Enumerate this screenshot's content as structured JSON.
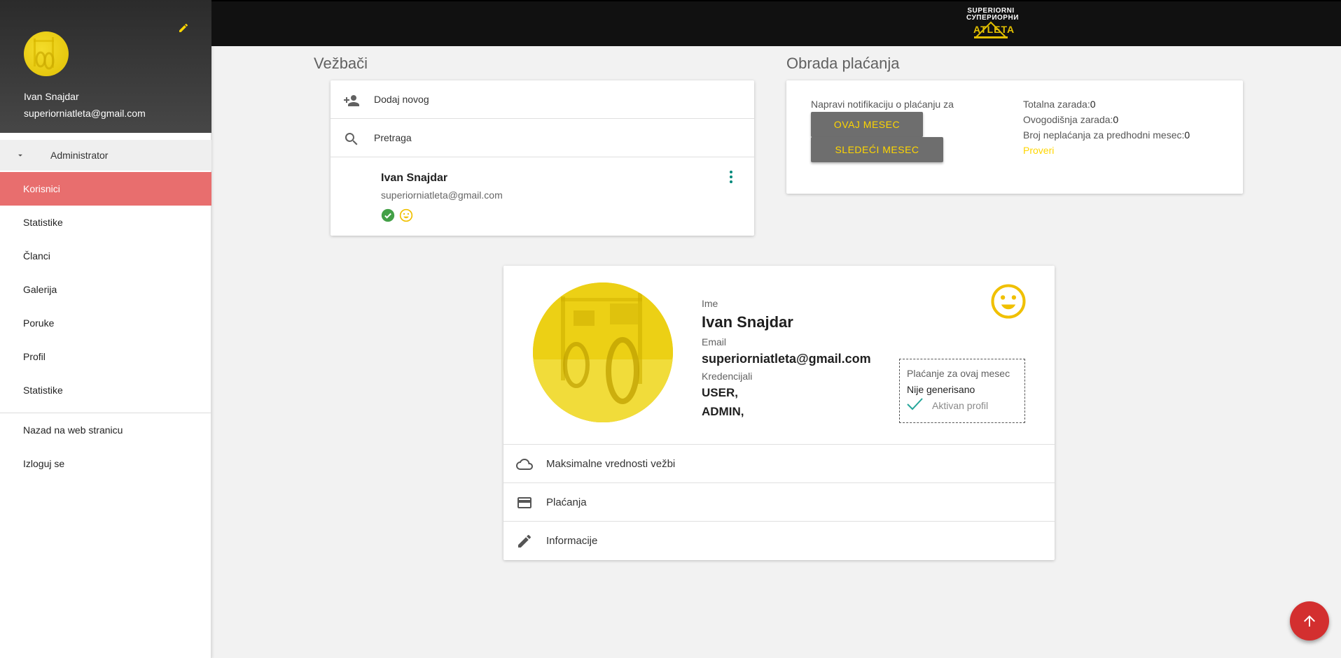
{
  "topbar": {
    "logo_line1": "SUPERIORNI",
    "logo_line2": "СУПЕРИОРНИ",
    "logo_line3": "ATLETA",
    "logo_icon": "barbell-logo-icon"
  },
  "sidebar": {
    "user_name": "Ivan Snajdar",
    "user_email": "superiorniatleta@gmail.com",
    "group_label": "Administrator",
    "items": [
      {
        "label": "Korisnici",
        "active": true
      },
      {
        "label": "Statistike",
        "active": false
      },
      {
        "label": "Članci",
        "active": false
      },
      {
        "label": "Galerija",
        "active": false
      },
      {
        "label": "Poruke",
        "active": false
      },
      {
        "label": "Profil",
        "active": false
      },
      {
        "label": "Statistike",
        "active": false
      }
    ],
    "footer_items": [
      {
        "label": "Nazad na web stranicu"
      },
      {
        "label": "Izloguj se"
      }
    ],
    "accent_color": "#e86e6e"
  },
  "vezbaci": {
    "title": "Vežbači",
    "add_label": "Dodaj novog",
    "search_label": "Pretraga",
    "user": {
      "name": "Ivan Snajdar",
      "email": "superiorniatleta@gmail.com",
      "status_icons": [
        "check-circle-icon",
        "smile-icon"
      ]
    }
  },
  "placanja": {
    "title": "Obrada plaćanja",
    "notify_label": "Napravi notifikaciju o plaćanju za",
    "btn_this_month": "OVAJ MESEC",
    "btn_next_month": "SLEDEĆI MESEC",
    "total_label": "Totalna zarada:",
    "total_value": "0",
    "year_label": "Ovogodišnja zarada:",
    "year_value": "0",
    "unpaid_label": "Broj neplaćanja za predhodni mesec:",
    "unpaid_value": "0",
    "check_link": "Proveri"
  },
  "profile": {
    "name_label": "Ime",
    "name": "Ivan Snajdar",
    "email_label": "Email",
    "email": "superiorniatleta@gmail.com",
    "cred_label": "Kredencijali",
    "cred_1": "USER,",
    "cred_2": "ADMIN,",
    "payment_title": "Plaćanje za ovaj mesec",
    "payment_status": "Nije generisano",
    "active_label": "Aktivan profil",
    "rows": [
      {
        "label": "Maksimalne vrednosti vežbi",
        "icon": "cloud-icon"
      },
      {
        "label": "Plaćanja",
        "icon": "credit-card-icon"
      },
      {
        "label": "Informacije",
        "icon": "pencil-icon"
      }
    ]
  },
  "colors": {
    "yellow": "#ffd600",
    "fab": "#d32f2f",
    "topbar": "#111111"
  }
}
